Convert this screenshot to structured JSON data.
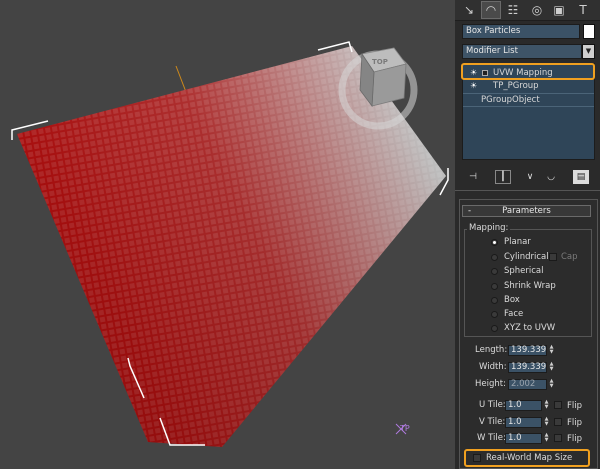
{
  "viewport": {
    "viewcube_label": "TOP",
    "particle_color_a": "#d41414",
    "particle_color_b": "#f0f0f0",
    "tp_label": "TP"
  },
  "panel": {
    "tabs": [
      "create-icon",
      "modify-icon",
      "hierarchy-icon",
      "motion-icon",
      "display-icon",
      "utilities-icon"
    ],
    "object_name": "Box Particles",
    "object_color": "#ffffff",
    "modifier_list_label": "Modifier List",
    "stack_items": [
      "UVW Mapping",
      "TP_PGroup",
      "PGroupObject"
    ],
    "parameters": {
      "rollout_title": "Parameters",
      "collapse_symbol": "-",
      "mapping_label": "Mapping:",
      "mapping_options": [
        "Planar",
        "Cylindrical",
        "Spherical",
        "Shrink Wrap",
        "Box",
        "Face",
        "XYZ to UVW"
      ],
      "selected_mapping": "Planar",
      "cap_label": "Cap",
      "length_label": "Length:",
      "length_value": "139.339",
      "width_label": "Width:",
      "width_value": "139.339",
      "height_label": "Height:",
      "height_value": "2.002",
      "u_tile_label": "U Tile:",
      "u_tile_value": "1.0",
      "v_tile_label": "V Tile:",
      "v_tile_value": "1.0",
      "w_tile_label": "W Tile:",
      "w_tile_value": "1.0",
      "flip_label": "Flip",
      "real_world_label": "Real-World Map Size"
    },
    "highlight_color": "#f0a020"
  }
}
